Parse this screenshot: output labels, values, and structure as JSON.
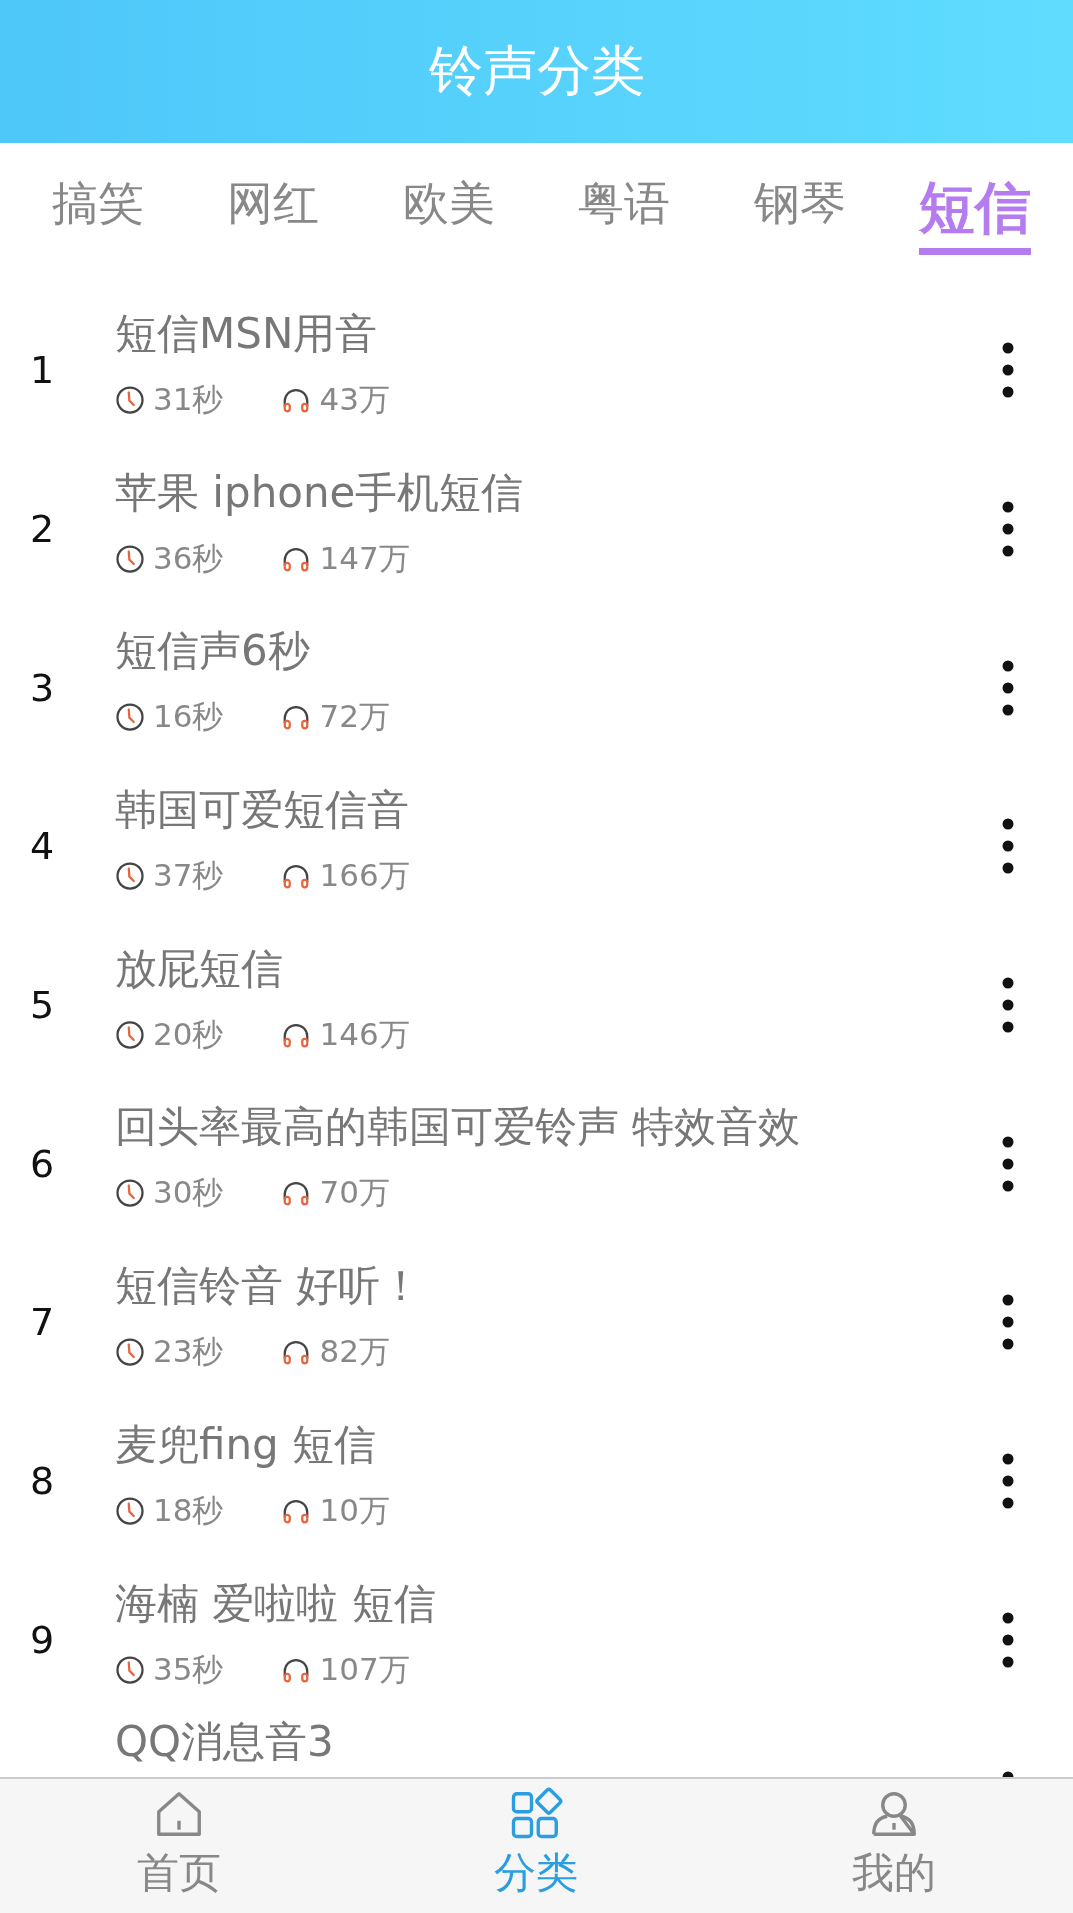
{
  "header": {
    "title": "铃声分类"
  },
  "tabs": [
    {
      "label": "搞笑",
      "selected": false
    },
    {
      "label": "网红",
      "selected": false
    },
    {
      "label": "欧美",
      "selected": false
    },
    {
      "label": "粤语",
      "selected": false
    },
    {
      "label": "钢琴",
      "selected": false
    },
    {
      "label": "短信",
      "selected": true
    }
  ],
  "ringtones": [
    {
      "rank": "1",
      "title": "短信MSN用音",
      "duration": "31秒",
      "plays": "43万"
    },
    {
      "rank": "2",
      "title": "苹果 iphone手机短信",
      "duration": "36秒",
      "plays": "147万"
    },
    {
      "rank": "3",
      "title": "短信声6秒",
      "duration": "16秒",
      "plays": "72万"
    },
    {
      "rank": "4",
      "title": "韩国可爱短信音",
      "duration": "37秒",
      "plays": "166万"
    },
    {
      "rank": "5",
      "title": "放屁短信",
      "duration": "20秒",
      "plays": "146万"
    },
    {
      "rank": "6",
      "title": "回头率最高的韩国可爱铃声 特效音效",
      "duration": "30秒",
      "plays": "70万"
    },
    {
      "rank": "7",
      "title": "短信铃音 好听！",
      "duration": "23秒",
      "plays": "82万"
    },
    {
      "rank": "8",
      "title": "麦兜fing 短信",
      "duration": "18秒",
      "plays": "10万"
    },
    {
      "rank": "9",
      "title": "海楠 爱啦啦 短信",
      "duration": "35秒",
      "plays": "107万"
    },
    {
      "title": "QQ消息音3"
    }
  ],
  "bottom_nav": [
    {
      "label": "首页",
      "kind": "home",
      "selected": false
    },
    {
      "label": "分类",
      "kind": "grid",
      "selected": true
    },
    {
      "label": "我的",
      "kind": "person",
      "selected": false
    }
  ]
}
